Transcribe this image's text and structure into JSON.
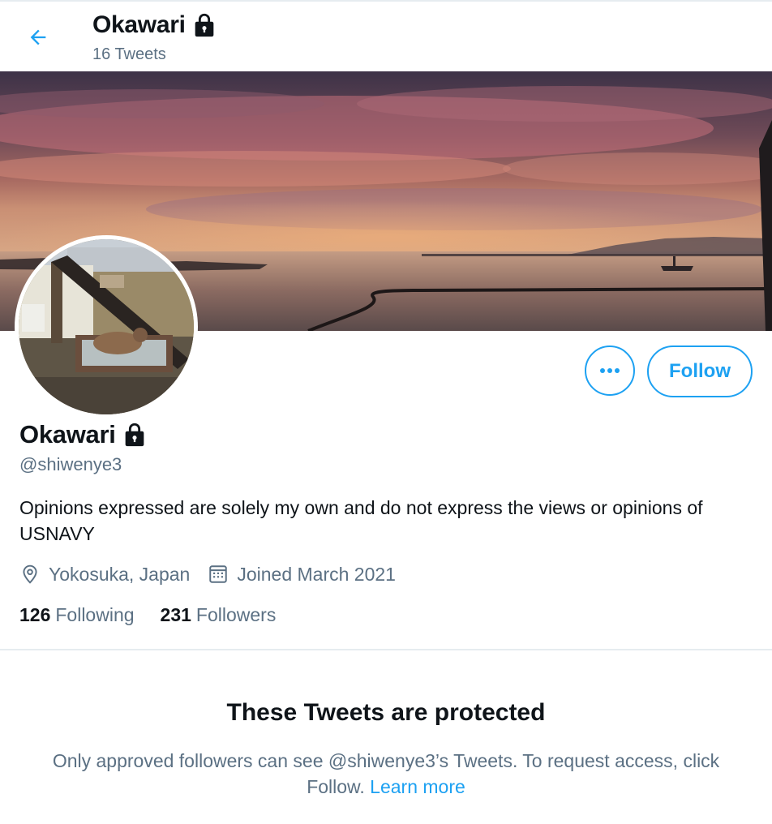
{
  "header": {
    "name": "Okawari",
    "tweet_count": "16 Tweets"
  },
  "profile": {
    "name": "Okawari",
    "handle": "@shiwenye3",
    "bio": "Opinions expressed are solely my own and do not express the views or opinions of USNAVY",
    "location": "Yokosuka, Japan",
    "joined": "Joined March 2021",
    "following_count": "126",
    "following_label": "Following",
    "followers_count": "231",
    "followers_label": "Followers"
  },
  "actions": {
    "follow_label": "Follow"
  },
  "protected": {
    "title": "These Tweets are protected",
    "text": "Only approved followers can see @shiwenye3’s Tweets. To request access, click Follow.",
    "link": "Learn more"
  },
  "icons": {
    "back": "arrow-left-icon",
    "lock": "lock-icon",
    "more": "more-horizontal-icon",
    "location": "location-pin-icon",
    "calendar": "calendar-icon"
  },
  "colors": {
    "accent": "#1da1f2",
    "secondary_text": "#5b7083",
    "primary_text": "#0f1419"
  }
}
